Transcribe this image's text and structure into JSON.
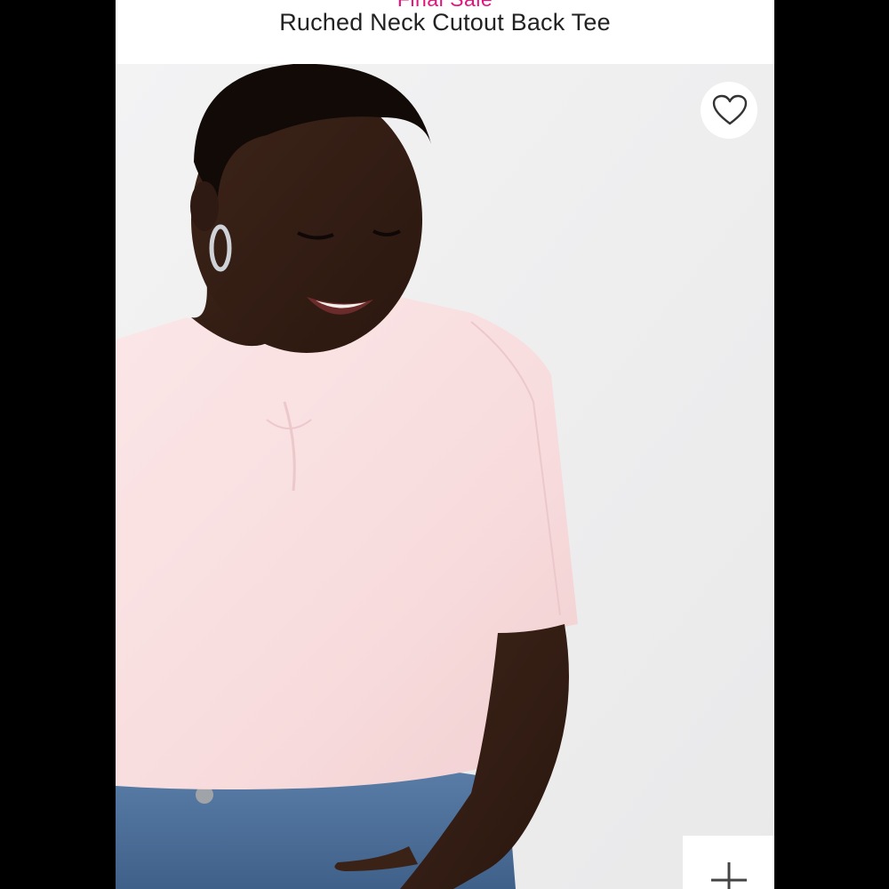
{
  "header": {
    "sale_label": "Final Sale",
    "product_title": "Ruched Neck Cutout Back Tee"
  },
  "product_image": {
    "alt": "Ruched Neck Cutout Back Tee"
  },
  "icons": {
    "favorite": "heart-outline-icon",
    "add": "plus-icon"
  },
  "colors": {
    "sale_accent": "#e5127d",
    "title_text": "#222222",
    "tee": "#f9dfe0",
    "denim": "#4a6d96"
  }
}
